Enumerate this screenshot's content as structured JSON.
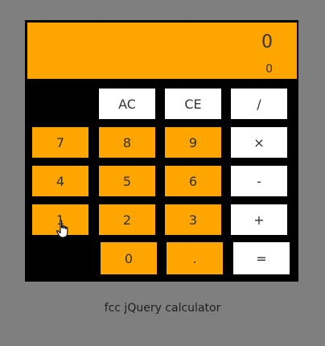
{
  "display": {
    "main_value": "0",
    "sub_value": "0"
  },
  "buttons": {
    "ac": "AC",
    "ce": "CE",
    "divide": "/",
    "seven": "7",
    "eight": "8",
    "nine": "9",
    "multiply": "×",
    "four": "4",
    "five": "5",
    "six": "6",
    "subtract": "-",
    "one": "1",
    "two": "2",
    "three": "3",
    "add": "+",
    "zero": "0",
    "decimal": ".",
    "equals": "="
  },
  "caption": "fcc jQuery calculator",
  "colors": {
    "background": "#7f7f7f",
    "calculator_body": "#000000",
    "accent_orange": "#ffa500",
    "operator_white": "#ffffff"
  },
  "icons": {
    "cursor": "hand-pointer-icon"
  }
}
